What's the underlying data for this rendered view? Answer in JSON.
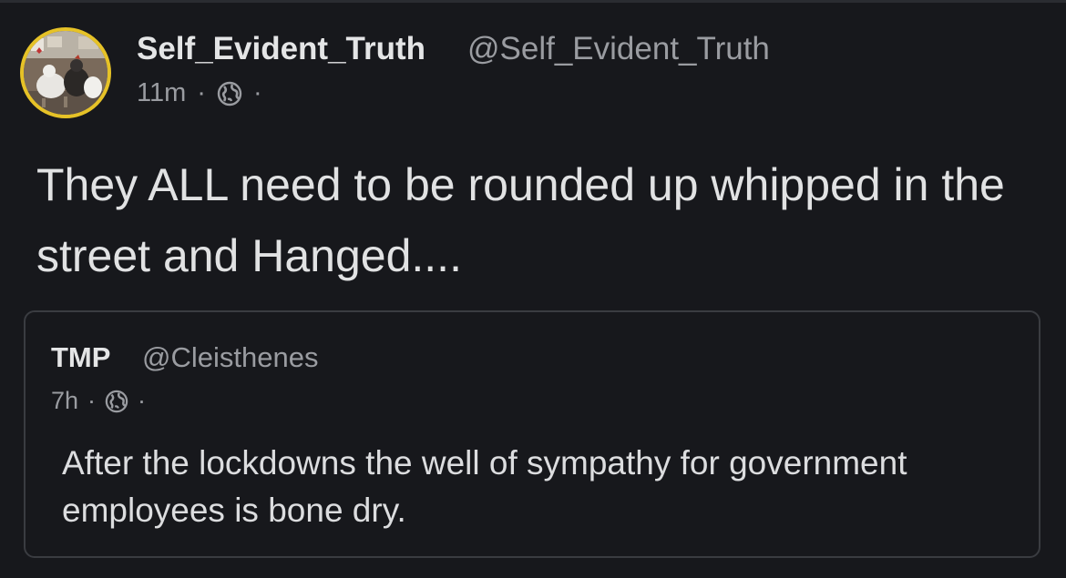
{
  "post": {
    "author_name": "Self_Evident_Truth",
    "author_handle": "@Self_Evident_Truth",
    "time": "11m",
    "separator": "·",
    "visibility_icon": "globe-icon",
    "text": "They ALL need to be rounded up whipped in the street and Hanged...."
  },
  "quote": {
    "author_name": "TMP",
    "author_handle": "@Cleisthenes",
    "time": "7h",
    "separator": "·",
    "visibility_icon": "globe-icon",
    "text": "After the lockdowns the well of sympathy for government employees is bone dry."
  },
  "colors": {
    "background": "#17181c",
    "avatar_ring": "#e6c227",
    "muted_text": "#9a9ca1",
    "quote_border": "#3a3c41"
  }
}
